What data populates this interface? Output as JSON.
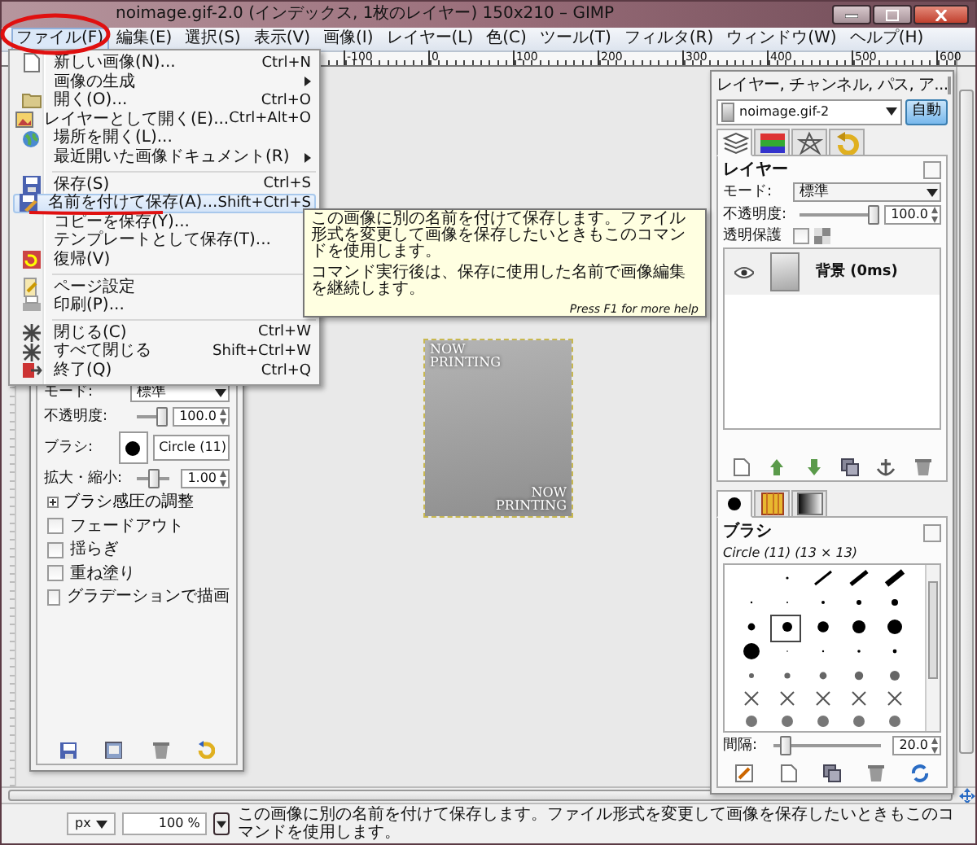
{
  "window": {
    "title": "noimage.gif-2.0 (インデックス, 1枚のレイヤー) 150x210 – GIMP"
  },
  "menubar": [
    {
      "label": "ファイル(F)",
      "selected": true
    },
    {
      "label": "編集(E)",
      "selected": false
    },
    {
      "label": "選択(S)",
      "selected": false
    },
    {
      "label": "表示(V)",
      "selected": false
    },
    {
      "label": "画像(I)",
      "selected": false
    },
    {
      "label": "レイヤー(L)",
      "selected": false
    },
    {
      "label": "色(C)",
      "selected": false
    },
    {
      "label": "ツール(T)",
      "selected": false
    },
    {
      "label": "フィルタ(R)",
      "selected": false
    },
    {
      "label": "ウィンドウ(W)",
      "selected": false
    },
    {
      "label": "ヘルプ(H)",
      "selected": false
    }
  ],
  "ruler": {
    "labels": [
      "-100",
      "0",
      "100",
      "200",
      "300",
      "400",
      "500",
      "600"
    ]
  },
  "file_menu": [
    {
      "kind": "item",
      "label": "新しい画像(N)...",
      "shortcut": "Ctrl+N",
      "submenu": false,
      "selected": false
    },
    {
      "kind": "item",
      "label": "画像の生成",
      "submenu": true,
      "selected": false
    },
    {
      "kind": "item",
      "label": "開く(O)...",
      "shortcut": "Ctrl+O",
      "submenu": false,
      "selected": false
    },
    {
      "kind": "item",
      "label": "レイヤーとして開く(E)...",
      "shortcut": "Ctrl+Alt+O",
      "submenu": false,
      "selected": false
    },
    {
      "kind": "item",
      "label": "場所を開く(L)...",
      "submenu": false,
      "selected": false
    },
    {
      "kind": "item",
      "label": "最近開いた画像ドキュメント(R)",
      "submenu": true,
      "selected": false
    },
    {
      "kind": "separator"
    },
    {
      "kind": "item",
      "label": "保存(S)",
      "shortcut": "Ctrl+S",
      "submenu": false,
      "selected": false
    },
    {
      "kind": "item",
      "label": "名前を付けて保存(A)...",
      "shortcut": "Shift+Ctrl+S",
      "submenu": false,
      "selected": true
    },
    {
      "kind": "item",
      "label": "コピーを保存(Y)...",
      "submenu": false,
      "selected": false
    },
    {
      "kind": "item",
      "label": "テンプレートとして保存(T)...",
      "submenu": false,
      "selected": false
    },
    {
      "kind": "item",
      "label": "復帰(V)",
      "submenu": false,
      "selected": false
    },
    {
      "kind": "separator"
    },
    {
      "kind": "item",
      "label": "ページ設定",
      "submenu": false,
      "selected": false
    },
    {
      "kind": "item",
      "label": "印刷(P)...",
      "submenu": false,
      "selected": false
    },
    {
      "kind": "separator"
    },
    {
      "kind": "item",
      "label": "閉じる(C)",
      "shortcut": "Ctrl+W",
      "submenu": false,
      "selected": false
    },
    {
      "kind": "item",
      "label": "すべて閉じる",
      "shortcut": "Shift+Ctrl+W",
      "submenu": false,
      "selected": false
    },
    {
      "kind": "item",
      "label": "終了(Q)",
      "shortcut": "Ctrl+Q",
      "submenu": false,
      "selected": false
    }
  ],
  "tooltip": {
    "paragraphs": [
      "この画像に別の名前を付けて保存します。ファイル形式を変更して画像を保存したいときもこのコマンドを使用します。",
      "コマンド実行後は、保存に使用した名前で画像編集を継続します。"
    ],
    "help": "Press F1 for more help"
  },
  "annotations": [
    {
      "kind": "circle"
    },
    {
      "kind": "underline"
    }
  ],
  "image": {
    "top_text": [
      "NOW",
      "PRINTING"
    ],
    "bottom_text": [
      "NOW",
      "PRINTING"
    ]
  },
  "tool_options": {
    "mode_label": "モード:",
    "mode": "標準",
    "opacity_label": "不透明度:",
    "opacity": "100.0",
    "opacity_slider": {
      "level": 1
    },
    "brush_label": "ブラシ:",
    "brush": "Circle (11)",
    "scale_label": "拡大・縮小:",
    "scale": "1.00",
    "scale_slider": {
      "level": 0.5
    },
    "expander": {
      "label": "ブラシ感圧の調整",
      "expanded": false
    },
    "options": [
      {
        "label": "フェードアウト",
        "checked": false
      },
      {
        "label": "揺らぎ",
        "checked": false
      },
      {
        "label": "重ね塗り",
        "checked": false
      },
      {
        "label": "グラデーションで描画",
        "checked": false
      }
    ]
  },
  "layers_dock": {
    "title": "レイヤー, チャンネル, パス, ア...",
    "image": "noimage.gif-2",
    "auto_button": "自動",
    "tabs": [
      {
        "selected": true
      },
      {
        "selected": false
      },
      {
        "selected": false
      },
      {
        "selected": false
      }
    ],
    "heading": "レイヤー",
    "mode_label": "モード:",
    "mode": "標準",
    "opacity_label": "不透明度:",
    "opacity": "100.0",
    "level": 1,
    "lock_label": "透明保護",
    "lock": false,
    "layers": [
      {
        "name": "背景 (0ms)",
        "visible": true,
        "selected": true
      }
    ]
  },
  "brushes": {
    "tabs": [
      {
        "selected": true
      },
      {
        "selected": false
      },
      {
        "selected": false
      }
    ],
    "heading": "ブラシ",
    "current": "Circle (11) (13 × 13)",
    "spacing_label": "間隔:",
    "spacing": "20.0",
    "level": 0.1
  },
  "status_bar": {
    "unit": "px",
    "zoom": "100 %",
    "message": "この画像に別の名前を付けて保存します。ファイル形式を変更して画像を保存したいときもこのコマンドを使用します。"
  }
}
